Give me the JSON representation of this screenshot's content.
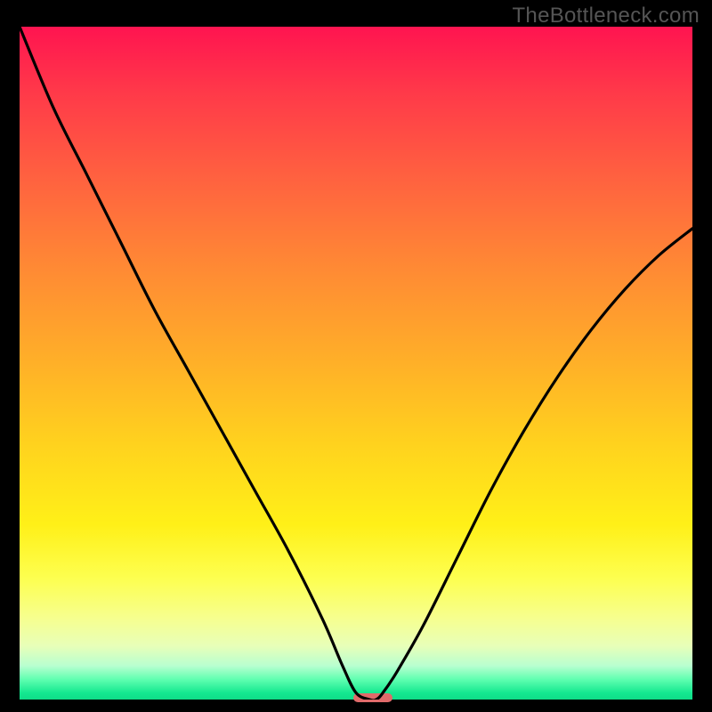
{
  "watermark": "TheBottleneck.com",
  "chart_data": {
    "type": "line",
    "title": "",
    "xlabel": "",
    "ylabel": "",
    "xlim": [
      0,
      100
    ],
    "ylim": [
      0,
      100
    ],
    "series": [
      {
        "name": "curve",
        "x": [
          0,
          5,
          10,
          15,
          20,
          25,
          30,
          35,
          40,
          45,
          48,
          50,
          52,
          53,
          54,
          56,
          60,
          65,
          70,
          75,
          80,
          85,
          90,
          95,
          100
        ],
        "values": [
          100,
          88,
          78,
          68,
          58,
          49,
          40,
          31,
          22,
          12,
          5,
          1,
          0,
          0,
          1,
          4,
          11,
          21,
          31,
          40,
          48,
          55,
          61,
          66,
          70
        ]
      }
    ],
    "minimum_marker": {
      "x_start": 50,
      "x_end": 55,
      "y": 0
    },
    "background_gradient": {
      "type": "vertical",
      "stops": [
        {
          "pos": 0.0,
          "color": "#ff1450"
        },
        {
          "pos": 0.22,
          "color": "#ff6040"
        },
        {
          "pos": 0.5,
          "color": "#ffb028"
        },
        {
          "pos": 0.74,
          "color": "#fff018"
        },
        {
          "pos": 0.92,
          "color": "#e8ffb8"
        },
        {
          "pos": 1.0,
          "color": "#0fdc88"
        }
      ]
    }
  }
}
